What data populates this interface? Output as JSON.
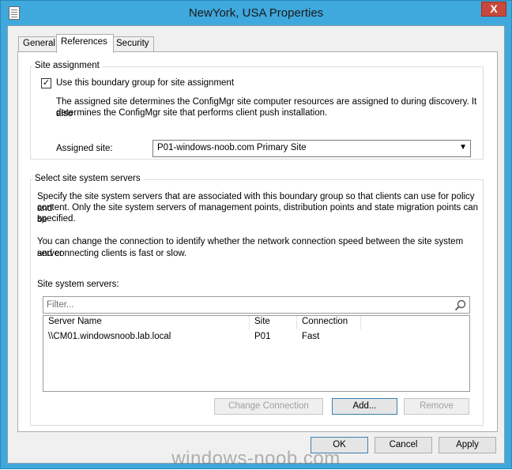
{
  "window": {
    "title": "NewYork, USA Properties",
    "close_label": "X"
  },
  "tabs": [
    {
      "label": "General"
    },
    {
      "label": "References"
    },
    {
      "label": "Security"
    }
  ],
  "site_assignment": {
    "legend": "Site assignment",
    "checkbox_label": "Use this boundary group for site assignment",
    "checked": true,
    "check_mark": "✓",
    "description_line1": "The assigned site determines the ConfigMgr site computer resources are assigned to during discovery. It also",
    "description_line2": "determines the ConfigMgr site that performs client push installation.",
    "assigned_site_label": "Assigned site:",
    "assigned_site_value": "P01-windows-noob.com Primary Site"
  },
  "site_system_servers": {
    "legend": "Select site system servers",
    "desc1_line1": "Specify the site system servers that are associated with this boundary group so that clients can use for policy and",
    "desc1_line2": "content. Only the site system servers of management points, distribution points and state migration points can be",
    "desc1_line3": "specified.",
    "desc2_line1": "You can change the connection to identify whether the network connection speed between the site system server",
    "desc2_line2": "and connecting clients is fast or slow.",
    "list_label": "Site system servers:",
    "filter_placeholder": "Filter...",
    "columns": [
      "Server Name",
      "Site",
      "Connection"
    ],
    "rows": [
      {
        "server": "\\\\CM01.windowsnoob.lab.local",
        "site": "P01",
        "connection": "Fast"
      }
    ],
    "buttons": {
      "change_connection": "Change Connection",
      "add": "Add...",
      "remove": "Remove"
    }
  },
  "dialog_buttons": {
    "ok": "OK",
    "cancel": "Cancel",
    "apply": "Apply"
  },
  "watermark": "windows-noob.com"
}
